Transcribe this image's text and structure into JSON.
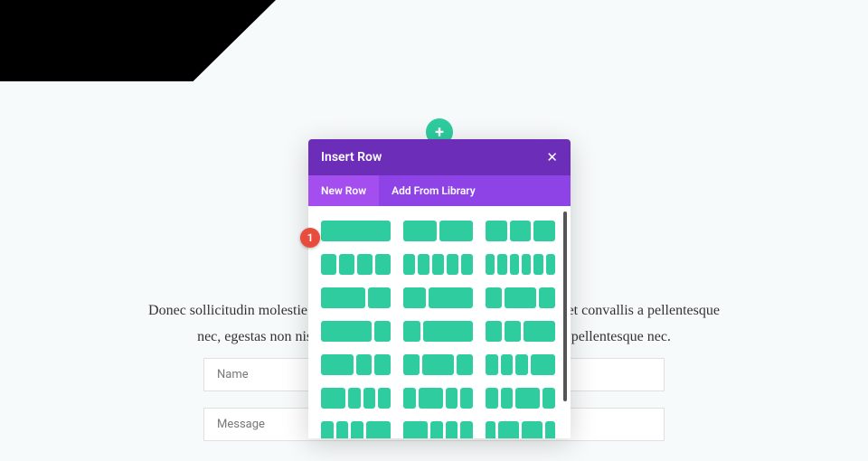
{
  "page": {
    "text_line1": "Donec sollicitudin molestie malesuada. Vivamus magna justo, lacinia eget convallis a pellentesque",
    "text_line2": "nec, egestas non nisi. Cras ultricies ligula sed magna convallis a pellentesque nec."
  },
  "form": {
    "name_placeholder": "Name",
    "message_placeholder": "Message"
  },
  "modal": {
    "title": "Insert Row",
    "close": "✕",
    "tabs": {
      "new": "New Row",
      "library": "Add From Library"
    }
  },
  "add_button": "+",
  "marker": "1"
}
